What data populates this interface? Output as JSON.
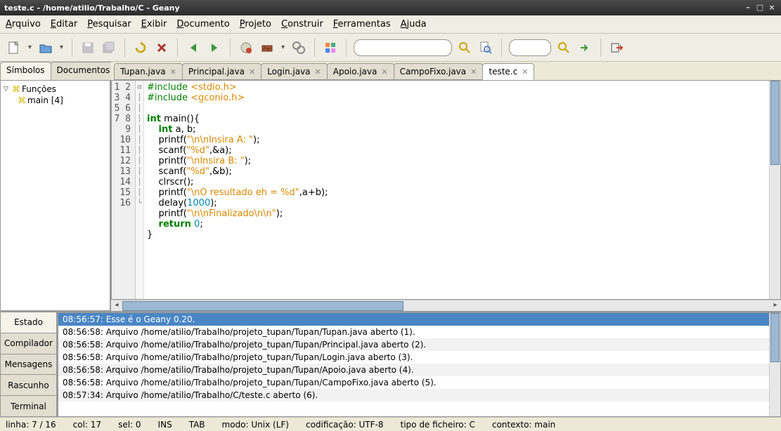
{
  "title": "teste.c - /home/atilio/Trabalho/C - Geany",
  "menu": [
    "Arquivo",
    "Editar",
    "Pesquisar",
    "Exibir",
    "Documento",
    "Projeto",
    "Construir",
    "Ferramentas",
    "Ajuda"
  ],
  "menu_accel": [
    "A",
    "E",
    "P",
    "E",
    "D",
    "P",
    "C",
    "F",
    "A"
  ],
  "side_tabs": [
    "Símbolos",
    "Documentos"
  ],
  "symbols": {
    "group": "Funções",
    "items": [
      "main [4]"
    ]
  },
  "file_tabs": [
    {
      "label": "Tupan.java",
      "active": false
    },
    {
      "label": "Principal.java",
      "active": false
    },
    {
      "label": "Login.java",
      "active": false
    },
    {
      "label": "Apoio.java",
      "active": false
    },
    {
      "label": "CampoFixo.java",
      "active": false
    },
    {
      "label": "teste.c",
      "active": true
    }
  ],
  "code_lines": [
    {
      "n": 1,
      "fold": "",
      "html": "<span class='pp'>#include</span> <span class='ppfile'>&lt;stdio.h&gt;</span>"
    },
    {
      "n": 2,
      "fold": "",
      "html": "<span class='pp'>#include</span> <span class='ppfile'>&lt;gconio.h&gt;</span>"
    },
    {
      "n": 3,
      "fold": "",
      "html": ""
    },
    {
      "n": 4,
      "fold": "⊟",
      "html": "<span class='kw'>int</span> main(){"
    },
    {
      "n": 5,
      "fold": "│",
      "html": "    <span class='kw'>int</span> a, b;"
    },
    {
      "n": 6,
      "fold": "│",
      "html": "    printf(<span class='str'>\"\\n\\nInsira A: \"</span>);"
    },
    {
      "n": 7,
      "fold": "│",
      "html": "    scanf(<span class='str'>\"%d\"</span>,&amp;a);"
    },
    {
      "n": 8,
      "fold": "│",
      "html": "    printf(<span class='str'>\"\\nInsira B: \"</span>);"
    },
    {
      "n": 9,
      "fold": "│",
      "html": "    scanf(<span class='str'>\"%d\"</span>,&amp;b);"
    },
    {
      "n": 10,
      "fold": "│",
      "html": "    clrscr();"
    },
    {
      "n": 11,
      "fold": "│",
      "html": "    printf(<span class='str'>\"\\nO resultado eh = %d\"</span>,a+b);"
    },
    {
      "n": 12,
      "fold": "│",
      "html": "    delay(<span class='num'>1000</span>);"
    },
    {
      "n": 13,
      "fold": "│",
      "html": "    printf(<span class='str'>\"\\n\\nFinalizado\\n\\n\"</span>);"
    },
    {
      "n": 14,
      "fold": "│",
      "html": "    <span class='kw'>return</span> <span class='num'>0</span>;"
    },
    {
      "n": 15,
      "fold": "└",
      "html": "}"
    },
    {
      "n": 16,
      "fold": "",
      "html": ""
    }
  ],
  "bottom_tabs": [
    "Estado",
    "Compilador",
    "Mensagens",
    "Rascunho",
    "Terminal"
  ],
  "messages": [
    {
      "sel": true,
      "t": "08:56:57: Esse é o Geany 0.20."
    },
    {
      "t": "08:56:58: Arquivo /home/atilio/Trabalho/projeto_tupan/Tupan/Tupan.java aberto (1)."
    },
    {
      "t": "08:56:58: Arquivo /home/atilio/Trabalho/projeto_tupan/Tupan/Principal.java aberto (2)."
    },
    {
      "t": "08:56:58: Arquivo /home/atilio/Trabalho/projeto_tupan/Tupan/Login.java aberto (3)."
    },
    {
      "t": "08:56:58: Arquivo /home/atilio/Trabalho/projeto_tupan/Tupan/Apoio.java aberto (4)."
    },
    {
      "t": "08:56:58: Arquivo /home/atilio/Trabalho/projeto_tupan/Tupan/CampoFixo.java aberto (5)."
    },
    {
      "t": "08:57:34: Arquivo /home/atilio/Trabalho/C/teste.c aberto (6)."
    }
  ],
  "status": {
    "line": "linha: 7 / 16",
    "col": "col: 17",
    "sel": "sel: 0",
    "ins": "INS",
    "tab": "TAB",
    "mode": "modo: Unix (LF)",
    "enc": "codificação: UTF-8",
    "ftype": "tipo de ficheiro: C",
    "ctx": "contexto: main"
  }
}
